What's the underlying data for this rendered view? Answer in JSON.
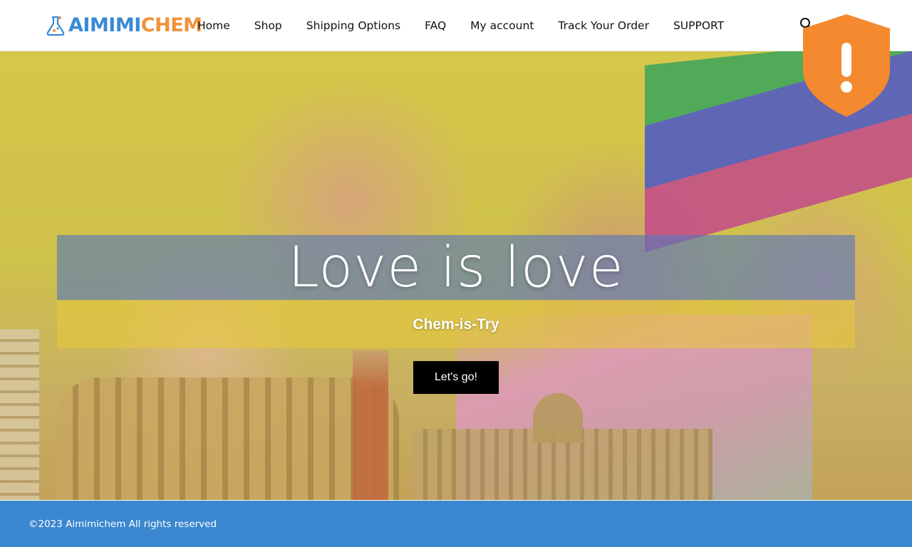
{
  "logo": {
    "part1": "AIMIMI",
    "part2": "CHEM"
  },
  "nav": {
    "items": [
      {
        "label": "Home"
      },
      {
        "label": "Shop"
      },
      {
        "label": "Shipping Options"
      },
      {
        "label": "FAQ"
      },
      {
        "label": "My account"
      },
      {
        "label": "Track Your Order"
      },
      {
        "label": "SUPPORT"
      }
    ]
  },
  "icons": {
    "search": "search-icon",
    "warning": "shield-warning-icon",
    "logo": "flask-icon"
  },
  "hero": {
    "title": "Love is love",
    "subtitle": "Chem-is-Try",
    "cta_label": "Let's go!"
  },
  "footer": {
    "copyright": "©2023 Aimimichem All rights reserved"
  },
  "colors": {
    "brand_blue": "#3a8ad6",
    "brand_orange": "#f0923a",
    "footer_blue": "#3a87cf",
    "shield_orange": "#f5892f"
  }
}
